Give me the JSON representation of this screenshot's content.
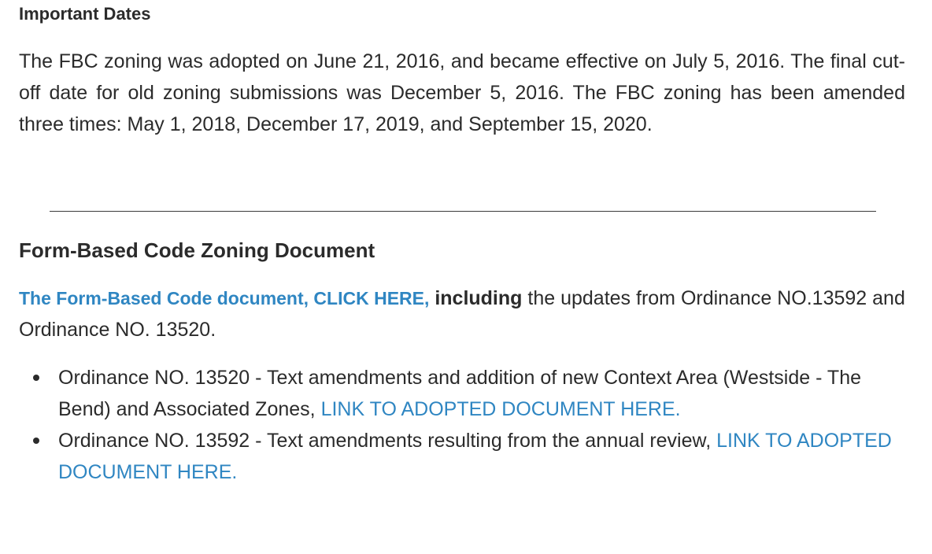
{
  "important_dates": {
    "heading": "Important Dates",
    "body": "The FBC zoning was adopted on June 21, 2016, and became effective on July 5, 2016. The final cut-off date for old zoning submissions was December 5, 2016. The FBC zoning has been amended three times: May 1, 2018, December 17, 2019, and September 15, 2020."
  },
  "document_section": {
    "heading": "Form-Based Code Zoning Document",
    "intro": {
      "link_text": "The Form-Based Code document, CLICK HERE,",
      "bold_text": "including",
      "rest_text": "the updates from Ordinance NO.13592 and Ordinance NO. 13520."
    },
    "ordinances": [
      {
        "text": "Ordinance NO. 13520 - Text amendments and addition of new Context Area (Westside - The Bend) and Associated Zones,",
        "link_text": "LINK TO ADOPTED DOCUMENT HERE."
      },
      {
        "text": "Ordinance NO. 13592 - Text amendments resulting from the annual review,",
        "link_text": "LINK TO ADOPTED DOCUMENT HERE."
      }
    ]
  },
  "colors": {
    "text": "#2b2b2b",
    "link": "#2f86c2",
    "background": "#ffffff"
  }
}
